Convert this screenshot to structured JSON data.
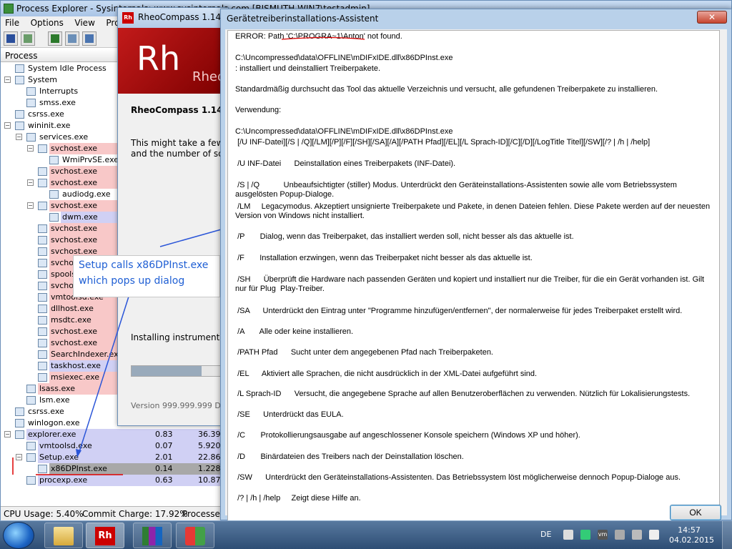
{
  "process_explorer": {
    "title": "Process Explorer - Sysinternals: www.sysinternals.com [BISMUTH-WIN7\\testadmin]",
    "menu": [
      "File",
      "Options",
      "View",
      "Process"
    ],
    "column_header": "Process",
    "processes": [
      {
        "name": "System Idle Process",
        "level": 0,
        "exp": "",
        "bg": ""
      },
      {
        "name": "System",
        "level": 0,
        "exp": "−",
        "bg": ""
      },
      {
        "name": "Interrupts",
        "level": 1,
        "exp": "",
        "bg": ""
      },
      {
        "name": "smss.exe",
        "level": 1,
        "exp": "",
        "bg": ""
      },
      {
        "name": "csrss.exe",
        "level": 0,
        "exp": "",
        "bg": ""
      },
      {
        "name": "wininit.exe",
        "level": 0,
        "exp": "−",
        "bg": ""
      },
      {
        "name": "services.exe",
        "level": 1,
        "exp": "−",
        "bg": ""
      },
      {
        "name": "svchost.exe",
        "level": 2,
        "exp": "−",
        "bg": "#f8c8c8"
      },
      {
        "name": "WmiPrvSE.exe",
        "level": 3,
        "exp": "",
        "bg": ""
      },
      {
        "name": "svchost.exe",
        "level": 2,
        "exp": "",
        "bg": "#f8c8c8"
      },
      {
        "name": "svchost.exe",
        "level": 2,
        "exp": "−",
        "bg": "#f8c8c8"
      },
      {
        "name": "audiodg.exe",
        "level": 3,
        "exp": "",
        "bg": ""
      },
      {
        "name": "svchost.exe",
        "level": 2,
        "exp": "−",
        "bg": "#f8c8c8"
      },
      {
        "name": "dwm.exe",
        "level": 3,
        "exp": "",
        "bg": "#d0d0f4"
      },
      {
        "name": "svchost.exe",
        "level": 2,
        "exp": "",
        "bg": "#f8c8c8"
      },
      {
        "name": "svchost.exe",
        "level": 2,
        "exp": "",
        "bg": "#f8c8c8"
      },
      {
        "name": "svchost.exe",
        "level": 2,
        "exp": "",
        "bg": "#f8c8c8"
      },
      {
        "name": "svchost.exe",
        "level": 2,
        "exp": "",
        "bg": "#f8c8c8"
      },
      {
        "name": "spoolsv.exe",
        "level": 2,
        "exp": "",
        "bg": "#f8c8c8"
      },
      {
        "name": "svchost.exe",
        "level": 2,
        "exp": "",
        "bg": "#f8c8c8"
      },
      {
        "name": "vmtoolsd.exe",
        "level": 2,
        "exp": "",
        "bg": "#f8c8c8"
      },
      {
        "name": "dllhost.exe",
        "level": 2,
        "exp": "",
        "bg": "#f8c8c8"
      },
      {
        "name": "msdtc.exe",
        "level": 2,
        "exp": "",
        "bg": "#f8c8c8"
      },
      {
        "name": "svchost.exe",
        "level": 2,
        "exp": "",
        "bg": "#f8c8c8"
      },
      {
        "name": "svchost.exe",
        "level": 2,
        "exp": "",
        "bg": "#f8c8c8"
      },
      {
        "name": "SearchIndexer.exe",
        "level": 2,
        "exp": "",
        "bg": "#f8c8c8"
      },
      {
        "name": "taskhost.exe",
        "level": 2,
        "exp": "",
        "bg": "#d0d0f4"
      },
      {
        "name": "msiexec.exe",
        "level": 2,
        "exp": "",
        "bg": "#f8c8c8"
      },
      {
        "name": "lsass.exe",
        "level": 1,
        "exp": "",
        "bg": "#f8c8c8"
      },
      {
        "name": "lsm.exe",
        "level": 1,
        "exp": "",
        "bg": ""
      },
      {
        "name": "csrss.exe",
        "level": 0,
        "exp": "",
        "bg": ""
      },
      {
        "name": "winlogon.exe",
        "level": 0,
        "exp": "",
        "bg": ""
      },
      {
        "name": "explorer.exe",
        "level": 0,
        "exp": "−",
        "bg": "#d0d0f4"
      },
      {
        "name": "vmtoolsd.exe",
        "level": 1,
        "exp": "",
        "bg": "#d0d0f4"
      },
      {
        "name": "Setup.exe",
        "level": 1,
        "exp": "−",
        "bg": "#d0d0f4"
      },
      {
        "name": "x86DPInst.exe",
        "level": 2,
        "exp": "",
        "bg": "#a8a8a8"
      },
      {
        "name": "procexp.exe",
        "level": 1,
        "exp": "",
        "bg": "#d0d0f4"
      }
    ],
    "cpu_values": [
      {
        "row": 32,
        "cpu": "0.83",
        "mem": "36.396"
      },
      {
        "row": 33,
        "cpu": "0.07",
        "mem": "5.920"
      },
      {
        "row": 34,
        "cpu": "2.01",
        "mem": "22.868"
      },
      {
        "row": 35,
        "cpu": "0.14",
        "mem": "1.228"
      },
      {
        "row": 36,
        "cpu": "0.63",
        "mem": "10.876"
      }
    ],
    "status": {
      "cpu": "CPU Usage: 5.40%",
      "commit": "Commit Charge: 17.92%",
      "processes": "Processes:"
    }
  },
  "rheo_setup": {
    "title": "RheoCompass 1.14 - In",
    "banner_big": "Rh",
    "banner_small": "Rheo",
    "heading": "RheoCompass 1.14 Set",
    "body_line1": "This might take a few m",
    "body_line2": "and the number of soft",
    "status": "Installing instrument dr",
    "progress": 0.33,
    "version": "Version 999.999.999 DEB"
  },
  "dialog": {
    "title": "Gerätetreiberinstallations-Assistent",
    "close": "✕",
    "ok": "OK",
    "lines": [
      {
        "t": "ERROR: Path 'C:\\PROGRA~1\\Anton' not found."
      },
      {
        "t": "C:\\Uncompressed\\data\\OFFLINE\\mDIFxIDE.dll\\x86DPInst.exe"
      },
      {
        "t": ": installiert und deinstalliert Treiberpakete."
      },
      {
        "t": "Standardmäßig durchsucht das Tool das aktuelle Verzeichnis und versucht, alle gefundenen Treiberpakete zu installieren."
      },
      {
        "t": "Verwendung:"
      },
      {
        "t": "C:\\Uncompressed\\data\\OFFLINE\\mDIFxIDE.dll\\x86DPInst.exe"
      },
      {
        "t": " [/U INF-Datei][/S | /Q][/LM][/P][/F][/SH][/SA][/A][/PATH Pfad][/EL][/L Sprach-ID][/C][/D][/LogTitle Titel][/SW][/? | /h | /help]"
      },
      {
        "t": " /U INF-Datei      Deinstallation eines Treiberpakets (INF-Datei)."
      },
      {
        "t": " /S | /Q           Unbeaufsichtigter (stiller) Modus. Unterdrückt den Geräteinstallations-Assistenten sowie alle vom Betriebssystem ausgelösten Popup-Dialoge."
      },
      {
        "t": " /LM     Legacymodus. Akzeptiert unsignierte Treiberpakete und Pakete, in denen Dateien fehlen. Diese Pakete werden auf der neuesten Version von Windows nicht installiert."
      },
      {
        "t": " /P       Dialog, wenn das Treiberpaket, das installiert werden soll, nicht besser als das aktuelle ist."
      },
      {
        "t": " /F       Installation erzwingen, wenn das Treiberpaket nicht besser als das aktuelle ist."
      },
      {
        "t": " /SH      Überprüft die Hardware nach passenden Geräten und kopiert und installiert nur die Treiber, für die ein Gerät vorhanden ist. Gilt nur für Plug  Play-Treiber."
      },
      {
        "t": " /SA      Unterdrückt den Eintrag unter \"Programme hinzufügen/entfernen\", der normalerweise für jedes Treiberpaket erstellt wird."
      },
      {
        "t": " /A       Alle oder keine installieren."
      },
      {
        "t": " /PATH Pfad      Sucht unter dem angegebenen Pfad nach Treiberpaketen."
      },
      {
        "t": " /EL      Aktiviert alle Sprachen, die nicht ausdrücklich in der XML-Datei aufgeführt sind."
      },
      {
        "t": " /L Sprach-ID      Versucht, die angegebene Sprache auf allen Benutzeroberflächen zu verwenden. Nützlich für Lokalisierungstests."
      },
      {
        "t": " /SE      Unterdrückt das EULA."
      },
      {
        "t": " /C       Protokollierungsausgabe auf angeschlossener Konsole speichern (Windows XP und höher)."
      },
      {
        "t": " /D       Binärdateien des Treibers nach der Deinstallation löschen."
      },
      {
        "t": " /SW      Unterdrückt den Geräteinstallations-Assistenten. Das Betriebssystem löst möglicherweise dennoch Popup-Dialoge aus."
      },
      {
        "t": " /? | /h | /help     Zeigt diese Hilfe an."
      }
    ]
  },
  "annotation": {
    "line1": "Setup calls x86DPInst.exe",
    "line2": "which pops up dialog",
    "color": "#1f5fd4"
  },
  "taskbar": {
    "lang": "DE",
    "time": "14:57",
    "date": "04.02.2015",
    "vm_badge": "vm",
    "rh_badge": "Rh"
  }
}
